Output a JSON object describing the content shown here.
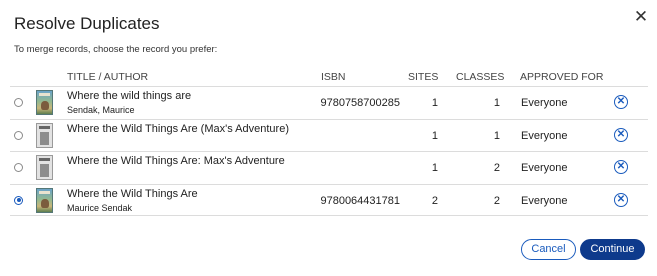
{
  "dialog": {
    "title": "Resolve Duplicates",
    "subtitle": "To merge records, choose the record you prefer:",
    "close_icon": "close-icon",
    "columns": {
      "title_author": "TITLE / AUTHOR",
      "isbn": "ISBN",
      "sites": "SITES",
      "classes": "CLASSES",
      "approved_for": "APPROVED FOR"
    },
    "rows": [
      {
        "selected": false,
        "cover": "book-cover-color-icon",
        "title": "Where the wild things are",
        "author": "Sendak, Maurice",
        "isbn": "9780758700285",
        "sites": "1",
        "classes": "1",
        "approved_for": "Everyone"
      },
      {
        "selected": false,
        "cover": "book-cover-placeholder-icon",
        "title": "Where the Wild Things Are (Max's Adventure)",
        "author": "",
        "isbn": "",
        "sites": "1",
        "classes": "1",
        "approved_for": "Everyone"
      },
      {
        "selected": false,
        "cover": "book-cover-placeholder-icon",
        "title": "Where the Wild Things Are: Max's Adventure",
        "author": "",
        "isbn": "",
        "sites": "1",
        "classes": "2",
        "approved_for": "Everyone"
      },
      {
        "selected": true,
        "cover": "book-cover-color-icon",
        "title": "Where the Wild Things Are",
        "author": "Maurice Sendak",
        "isbn": "9780064431781",
        "sites": "2",
        "classes": "2",
        "approved_for": "Everyone"
      }
    ],
    "buttons": {
      "cancel": "Cancel",
      "continue": "Continue"
    },
    "colors": {
      "accent": "#1a5bbd",
      "primary_button": "#0e3a8c",
      "divider": "#dcdcdc"
    }
  }
}
